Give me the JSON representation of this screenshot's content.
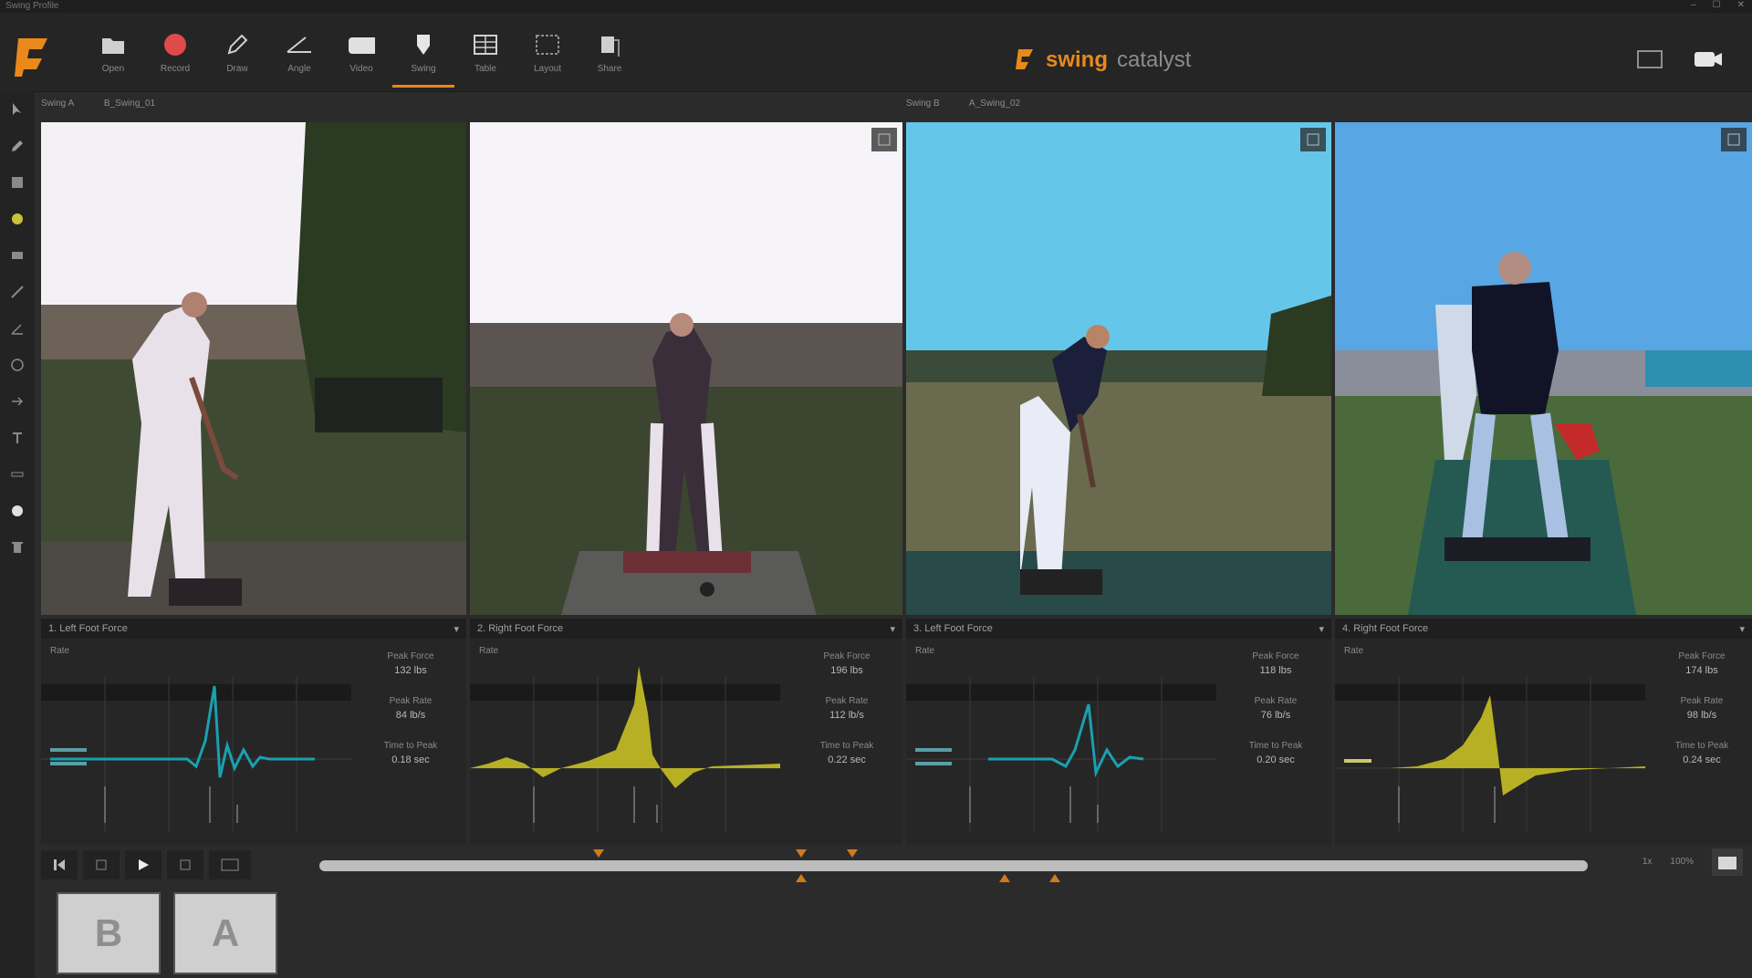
{
  "window": {
    "title": "Swing Profile",
    "controls": [
      "–",
      "☐",
      "✕"
    ]
  },
  "toolbar": {
    "tools": [
      {
        "label": "Open",
        "icon": "folder-icon"
      },
      {
        "label": "Record",
        "icon": "record-icon"
      },
      {
        "label": "Draw",
        "icon": "pen-icon"
      },
      {
        "label": "Angle",
        "icon": "angle-icon"
      },
      {
        "label": "Video",
        "icon": "camera-icon"
      },
      {
        "label": "Swing",
        "icon": "swing-icon"
      },
      {
        "label": "Table",
        "icon": "table-icon"
      },
      {
        "label": "Layout",
        "icon": "layout-icon"
      },
      {
        "label": "Share",
        "icon": "share-icon"
      }
    ],
    "active_tool_index": 5,
    "brand_word1": "swing",
    "brand_word2": "catalyst"
  },
  "video_groups": [
    {
      "tag": "Swing A",
      "name": "B_Swing_01"
    },
    {
      "tag": "Swing B",
      "name": "A_Swing_02"
    }
  ],
  "graphs": [
    {
      "header": "1. Left Foot Force",
      "sub": "Rate",
      "metrics": [
        {
          "k": "Peak Force",
          "v": "132 lbs"
        },
        {
          "k": "Peak Rate",
          "v": "84 lb/s"
        },
        {
          "k": "Time to Peak",
          "v": "0.18 sec"
        }
      ]
    },
    {
      "header": "2. Right Foot Force",
      "sub": "Rate",
      "metrics": [
        {
          "k": "Peak Force",
          "v": "196 lbs"
        },
        {
          "k": "Peak Rate",
          "v": "112 lb/s"
        },
        {
          "k": "Time to Peak",
          "v": "0.22 sec"
        }
      ]
    },
    {
      "header": "3. Left Foot Force",
      "sub": "Rate",
      "metrics": [
        {
          "k": "Peak Force",
          "v": "118 lbs"
        },
        {
          "k": "Peak Rate",
          "v": "76 lb/s"
        },
        {
          "k": "Time to Peak",
          "v": "0.20 sec"
        }
      ]
    },
    {
      "header": "4. Right Foot Force",
      "sub": "Rate",
      "metrics": [
        {
          "k": "Peak Force",
          "v": "174 lbs"
        },
        {
          "k": "Peak Rate",
          "v": "98 lb/s"
        },
        {
          "k": "Time to Peak",
          "v": "0.24 sec"
        }
      ]
    }
  ],
  "transport": {
    "position": 1.0,
    "speed_label": "1x",
    "zoom_label": "100%",
    "ticks_top": [
      0.22,
      0.38,
      0.42
    ],
    "ticks_bottom": [
      0.38,
      0.54,
      0.58
    ]
  },
  "thumbnails": [
    {
      "label": "B"
    },
    {
      "label": "A"
    }
  ],
  "colors": {
    "accent": "#e8891a",
    "teal": "#1aa0b0",
    "olive": "#b7b024"
  }
}
